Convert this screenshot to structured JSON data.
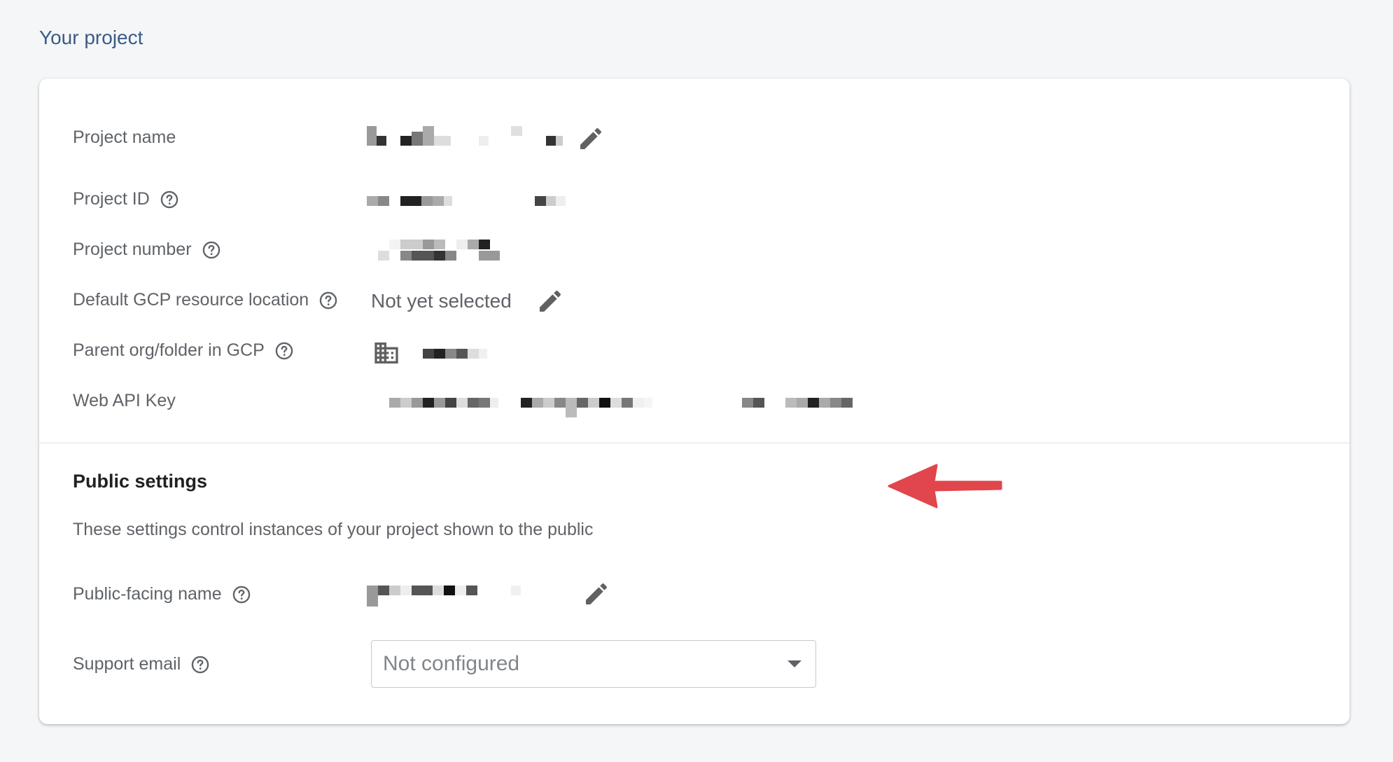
{
  "section_title": "Your project",
  "rows": {
    "project_name": {
      "label": "Project name"
    },
    "project_id": {
      "label": "Project ID"
    },
    "project_number": {
      "label": "Project number"
    },
    "gcp_location": {
      "label": "Default GCP resource location",
      "value": "Not yet selected"
    },
    "parent_org": {
      "label": "Parent org/folder in GCP"
    },
    "web_api_key": {
      "label": "Web API Key"
    }
  },
  "public_settings": {
    "heading": "Public settings",
    "description": "These settings control instances of your project shown to the public",
    "public_name": {
      "label": "Public-facing name"
    },
    "support_email": {
      "label": "Support email",
      "value": "Not configured"
    }
  },
  "icons": {
    "help": "help-circle-icon",
    "edit": "pencil-icon",
    "org": "building-icon",
    "dropdown": "caret-down-icon"
  },
  "colors": {
    "accent_title": "#3b5b86",
    "annotation_arrow": "#e0464b"
  }
}
